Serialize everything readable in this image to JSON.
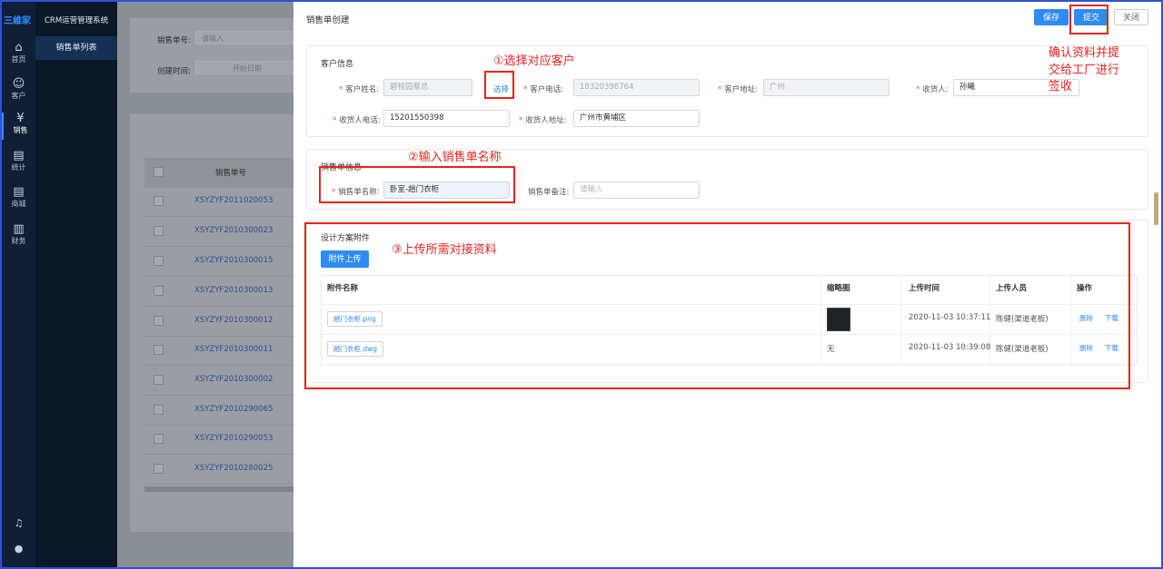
{
  "app": {
    "logo": "三維家",
    "system_title": "CRM运营管理系统",
    "nav": [
      {
        "icon": "home-icon",
        "label": "首页"
      },
      {
        "icon": "customer-icon",
        "label": "客户"
      },
      {
        "icon": "sales-icon",
        "label": "销售"
      },
      {
        "icon": "stats-icon",
        "label": "统计"
      },
      {
        "icon": "mall-icon",
        "label": "商城"
      },
      {
        "icon": "finance-icon",
        "label": "财务"
      }
    ],
    "submenu": "销售单列表"
  },
  "background_page": {
    "filter_order_label": "销售单号:",
    "filter_order_placeholder": "请输入",
    "filter_time_label": "创建时间:",
    "filter_time_placeholder": "开始日期",
    "column_header": "销售单号",
    "rows": [
      "XSYZYF2011020053",
      "XSYZYF2010300023",
      "XSYZYF2010300015",
      "XSYZYF2010300013",
      "XSYZYF2010300012",
      "XSYZYF2010300011",
      "XSYZYF2010300002",
      "XSYZYF2010290065",
      "XSYZYF2010290053",
      "XSYZYF2010280025"
    ]
  },
  "drawer": {
    "title": "销售单创建",
    "buttons": {
      "save": "保存",
      "submit": "提交",
      "close": "关闭"
    },
    "customer": {
      "section_title": "客户信息",
      "name_label": "客户姓名:",
      "name_value": "碧桂园蔡总",
      "select_link": "选择",
      "phone_label": "客户电话:",
      "phone_value": "18320398764",
      "address_label": "客户地址:",
      "address_value": "广州",
      "receiver_label": "收货人:",
      "receiver_value": "孙曦",
      "receiver_phone_label": "收货人电话:",
      "receiver_phone_value": "15201550398",
      "receiver_address_label": "收货人地址:",
      "receiver_address_value": "广州市黄埔区"
    },
    "order": {
      "section_title": "销售单信息",
      "name_label": "销售单名称:",
      "name_value": "卧室-趟门衣柜",
      "remark_label": "销售单备注:",
      "remark_placeholder": "请输入"
    },
    "attachments": {
      "section_title": "设计方案附件",
      "upload_button": "附件上传",
      "columns": [
        "附件名称",
        "缩略图",
        "上传时间",
        "上传人员",
        "操作"
      ],
      "rows": [
        {
          "name": "趟门衣柜.png",
          "thumbnail": "",
          "time": "2020-11-03 10:37:11",
          "uploader": "陈健(渠道老板)",
          "delete": "删除",
          "download": "下载"
        },
        {
          "name": "趟门衣柜.dwg",
          "thumbnail": "无",
          "time": "2020-11-03 10:39:08",
          "uploader": "陈健(渠道老板)",
          "delete": "删除",
          "download": "下载"
        }
      ]
    }
  },
  "annotations": {
    "step1": "①选择对应客户",
    "step2": "②输入销售单名称",
    "step3": "③上传所需对接资料",
    "submit_line1": "确认资料并提",
    "submit_line2": "交给工厂进行",
    "submit_line3": "签收"
  },
  "colors": {
    "primary": "#2f8cf2",
    "annotation": "#e8231f",
    "sidebar": "#0f2036"
  }
}
